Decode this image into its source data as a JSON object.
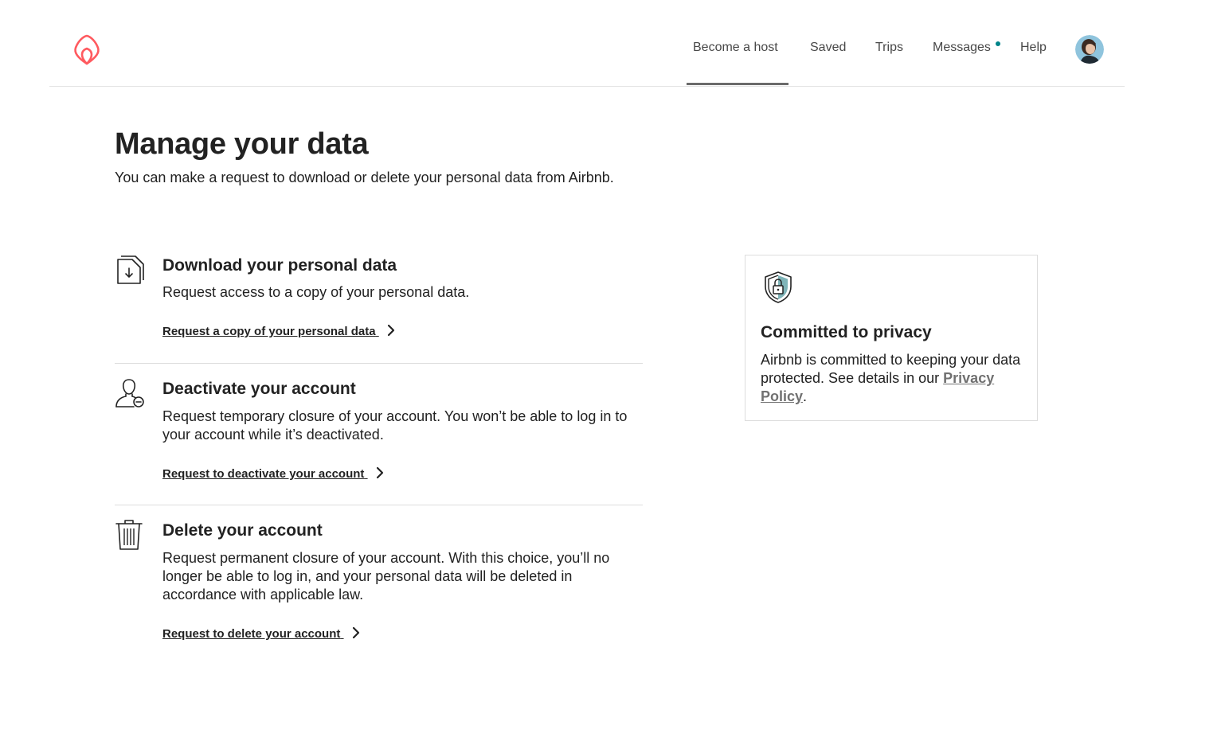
{
  "header": {
    "logo_icon": "airbnb-belo-icon",
    "brand_color": "#FF5A5F",
    "nav": [
      {
        "label": "Become a host",
        "active": true
      },
      {
        "label": "Saved"
      },
      {
        "label": "Trips"
      },
      {
        "label": "Messages",
        "has_notification": true
      },
      {
        "label": "Help"
      }
    ],
    "avatar_icon": "user-avatar"
  },
  "page": {
    "title": "Manage your data",
    "subtitle": "You can make a request to download or delete your personal data from Airbnb."
  },
  "sections": [
    {
      "icon": "download-document-icon",
      "title": "Download your personal data",
      "description": "Request access to a copy of your personal data.",
      "link": "Request a copy of your personal data"
    },
    {
      "icon": "user-minus-icon",
      "title": "Deactivate your account",
      "description": "Request temporary closure of your account. You won’t be able to log in to your account while it’s deactivated.",
      "link": "Request to deactivate your account"
    },
    {
      "icon": "trash-icon",
      "title": "Delete your account",
      "description": "Request permanent closure of your account. With this choice, you’ll no longer be able to log in, and your personal data will be deleted in accordance with applicable law.",
      "link": "Request to delete your account"
    }
  ],
  "privacy_card": {
    "icon": "shield-lock-icon",
    "title": "Committed to privacy",
    "text": "Airbnb is committed to keeping your data protected. See details in our",
    "link": "Privacy Policy",
    "after_link": "."
  },
  "colors": {
    "text": "#222222",
    "nav_text": "#484848",
    "divider": "#DDDDDD",
    "notification_dot": "#008489",
    "shield_accent": "#7FB4B8"
  }
}
